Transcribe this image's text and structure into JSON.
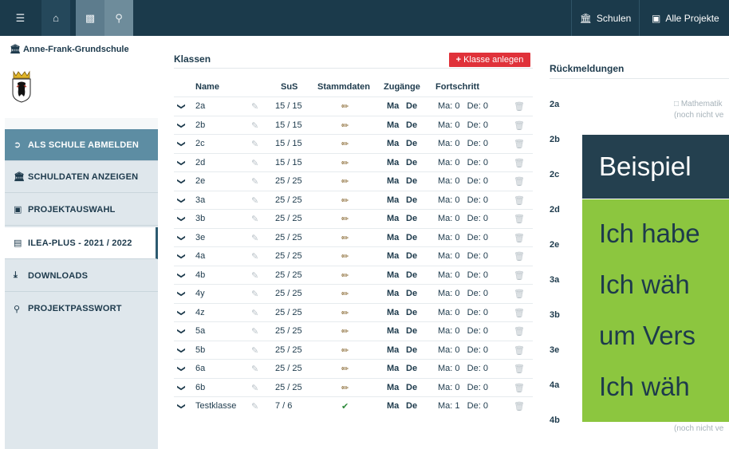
{
  "topbar": {
    "menu_icon": "menu-icon",
    "home_icon": "home-icon",
    "user_icon": "user-card-icon",
    "search_icon": "search-icon",
    "schulen_label": "Schulen",
    "projekte_label": "Alle Projekte"
  },
  "sidebar": {
    "school_name": "Anne-Frank-Grundschule",
    "items": [
      {
        "label": "ALS SCHULE ABMELDEN",
        "icon": "logout-icon"
      },
      {
        "label": "SCHULDATEN ANZEIGEN",
        "icon": "bank-icon"
      },
      {
        "label": "PROJEKTAUSWAHL",
        "icon": "sitemap-icon"
      },
      {
        "label": "ILEA-PLUS - 2021 / 2022",
        "icon": "list-icon"
      },
      {
        "label": "DOWNLOADS",
        "icon": "download-icon"
      },
      {
        "label": "PROJEKTPASSWORT",
        "icon": "key-icon"
      }
    ]
  },
  "klassen": {
    "title": "Klassen",
    "add_button": "Klasse anlegen",
    "headers": {
      "name": "Name",
      "sus": "SuS",
      "stammdaten": "Stammdaten",
      "zugaenge": "Zugänge",
      "fortschritt": "Fortschritt"
    },
    "rows": [
      {
        "name": "2a",
        "sus": "15 / 15",
        "ma": "Ma",
        "de": "De",
        "fortschritt": "Ma: 0   De: 0",
        "stamm_ok": false
      },
      {
        "name": "2b",
        "sus": "15 / 15",
        "ma": "Ma",
        "de": "De",
        "fortschritt": "Ma: 0   De: 0",
        "stamm_ok": false
      },
      {
        "name": "2c",
        "sus": "15 / 15",
        "ma": "Ma",
        "de": "De",
        "fortschritt": "Ma: 0   De: 0",
        "stamm_ok": false
      },
      {
        "name": "2d",
        "sus": "15 / 15",
        "ma": "Ma",
        "de": "De",
        "fortschritt": "Ma: 0   De: 0",
        "stamm_ok": false
      },
      {
        "name": "2e",
        "sus": "25 / 25",
        "ma": "Ma",
        "de": "De",
        "fortschritt": "Ma: 0   De: 0",
        "stamm_ok": false
      },
      {
        "name": "3a",
        "sus": "25 / 25",
        "ma": "Ma",
        "de": "De",
        "fortschritt": "Ma: 0   De: 0",
        "stamm_ok": false
      },
      {
        "name": "3b",
        "sus": "25 / 25",
        "ma": "Ma",
        "de": "De",
        "fortschritt": "Ma: 0   De: 0",
        "stamm_ok": false
      },
      {
        "name": "3e",
        "sus": "25 / 25",
        "ma": "Ma",
        "de": "De",
        "fortschritt": "Ma: 0   De: 0",
        "stamm_ok": false
      },
      {
        "name": "4a",
        "sus": "25 / 25",
        "ma": "Ma",
        "de": "De",
        "fortschritt": "Ma: 0   De: 0",
        "stamm_ok": false
      },
      {
        "name": "4b",
        "sus": "25 / 25",
        "ma": "Ma",
        "de": "De",
        "fortschritt": "Ma: 0   De: 0",
        "stamm_ok": false
      },
      {
        "name": "4y",
        "sus": "25 / 25",
        "ma": "Ma",
        "de": "De",
        "fortschritt": "Ma: 0   De: 0",
        "stamm_ok": false
      },
      {
        "name": "4z",
        "sus": "25 / 25",
        "ma": "Ma",
        "de": "De",
        "fortschritt": "Ma: 0   De: 0",
        "stamm_ok": false
      },
      {
        "name": "5a",
        "sus": "25 / 25",
        "ma": "Ma",
        "de": "De",
        "fortschritt": "Ma: 0   De: 0",
        "stamm_ok": false
      },
      {
        "name": "5b",
        "sus": "25 / 25",
        "ma": "Ma",
        "de": "De",
        "fortschritt": "Ma: 0   De: 0",
        "stamm_ok": false
      },
      {
        "name": "6a",
        "sus": "25 / 25",
        "ma": "Ma",
        "de": "De",
        "fortschritt": "Ma: 0   De: 0",
        "stamm_ok": false
      },
      {
        "name": "6b",
        "sus": "25 / 25",
        "ma": "Ma",
        "de": "De",
        "fortschritt": "Ma: 0   De: 0",
        "stamm_ok": false
      },
      {
        "name": "Testklasse",
        "sus": "7 / 6",
        "ma": "Ma",
        "de": "De",
        "fortschritt": "Ma: 1   De: 0",
        "stamm_ok": true
      }
    ]
  },
  "rueckmeldungen": {
    "title": "Rückmeldungen",
    "labels": [
      "2a",
      "2b",
      "2c",
      "2d",
      "2e",
      "3a",
      "3b",
      "3e",
      "4a",
      "4b"
    ],
    "note_top_1": "Mathematik",
    "note_top_2": "(noch nicht ve",
    "note_bottom": "(noch nicht ve"
  },
  "overlay": {
    "title": "Beispiel",
    "lines": [
      "Ich habe",
      "Ich wäh",
      "um Vers",
      "Ich wäh"
    ]
  }
}
